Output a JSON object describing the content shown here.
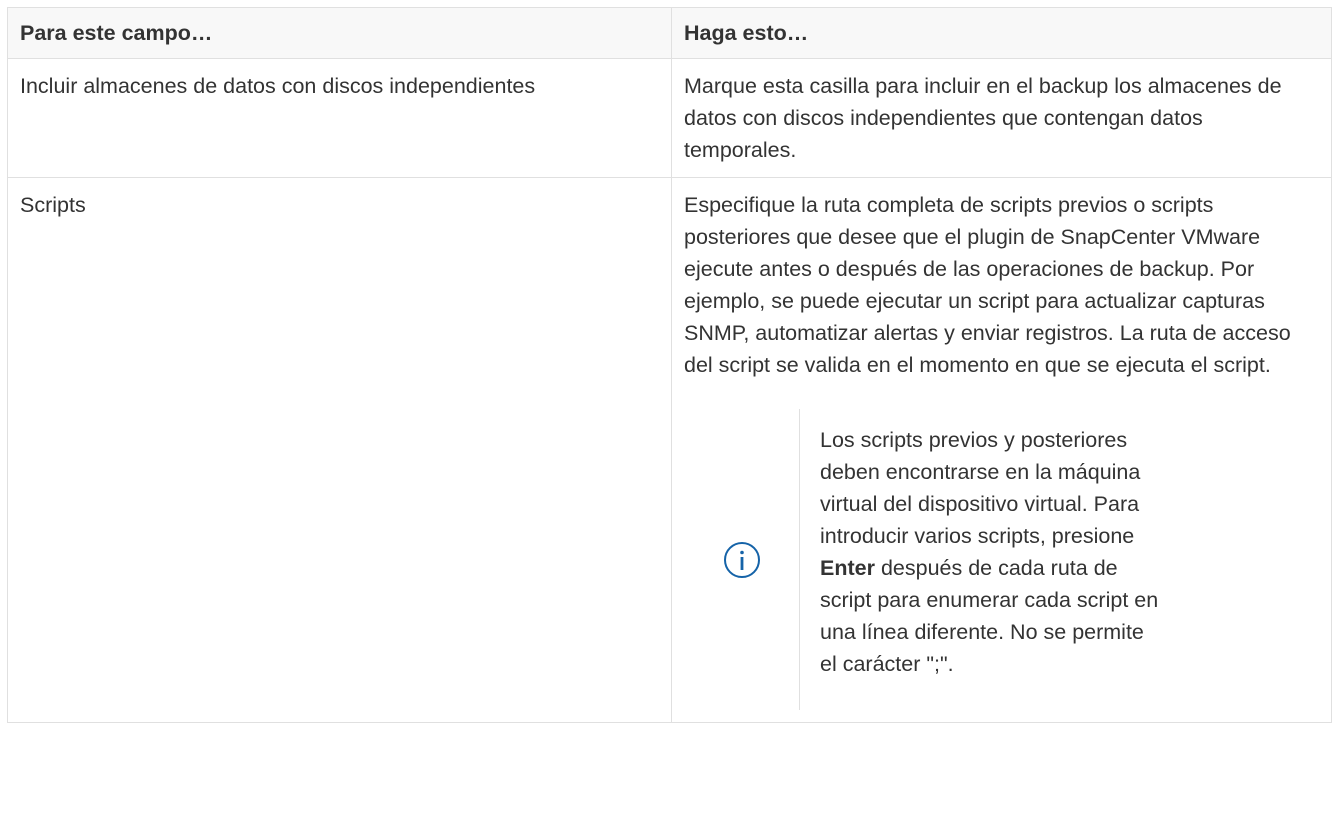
{
  "table": {
    "headers": [
      "Para este campo…",
      "Haga esto…"
    ],
    "rows": [
      {
        "field": "Incluir almacenes de datos con discos independientes",
        "action": "Marque esta casilla para incluir en el backup los almacenes de datos con discos independientes que contengan datos temporales."
      },
      {
        "field": "Scripts",
        "action": "Especifique la ruta completa de scripts previos o scripts posteriores que desee que el plugin de SnapCenter VMware ejecute antes o después de las operaciones de backup. Por ejemplo, se puede ejecutar un script para actualizar capturas SNMP, automatizar alertas y enviar registros. La ruta de acceso del script se valida en el momento en que se ejecuta el script.",
        "note": {
          "icon": "info-icon",
          "text_before": "Los scripts previos y posteriores deben encontrarse en la máquina virtual del dispositivo virtual. Para introducir varios scripts, presione ",
          "bold": "Enter",
          "text_after": " después de cada ruta de script para enumerar cada script en una línea diferente. No se permite el carácter \";\"."
        }
      }
    ]
  },
  "colors": {
    "text": "#333333",
    "header_bg": "#f8f8f8",
    "border": "#e0e0e0",
    "icon": "#1563a8"
  }
}
